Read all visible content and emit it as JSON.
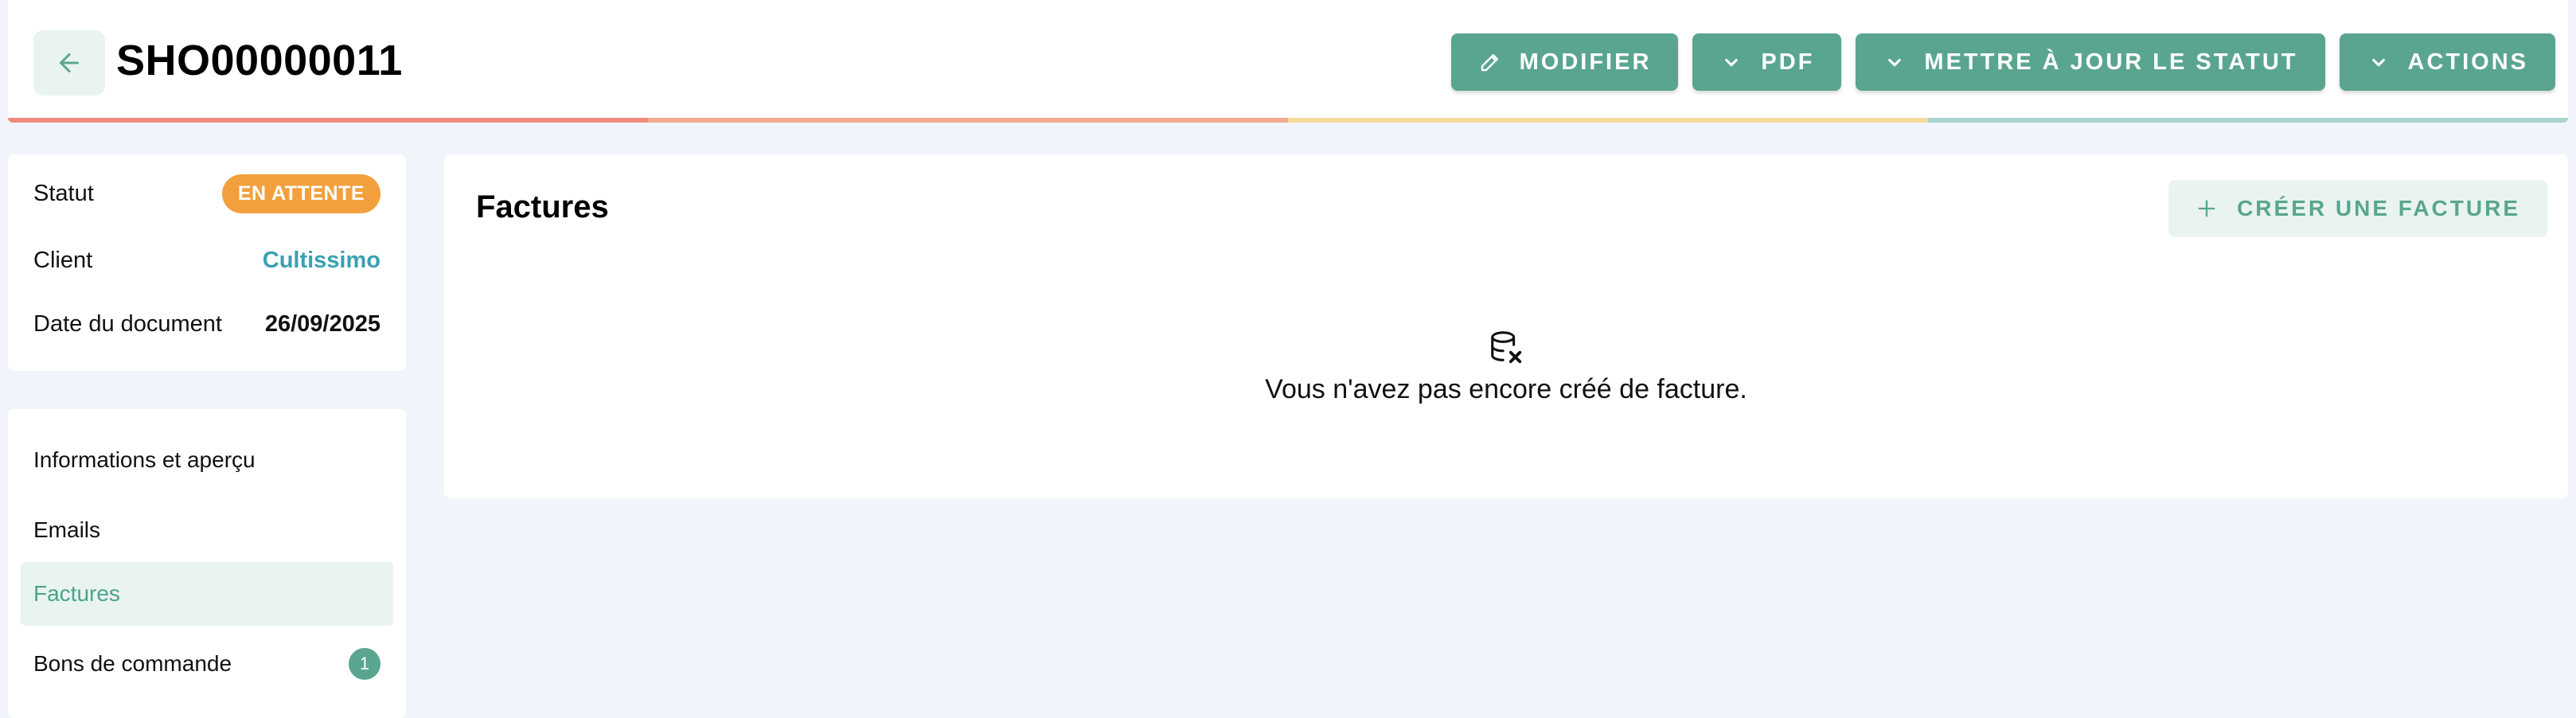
{
  "header": {
    "back_icon": "arrow-left-icon",
    "title": "SHO00000011",
    "buttons": {
      "edit": "MODIFIER",
      "pdf": "PDF",
      "update_status": "METTRE À JOUR LE STATUT",
      "actions": "ACTIONS"
    },
    "progress_colors": [
      "#ef8c81",
      "#f3a991",
      "#f7db9c",
      "#a9d4cf"
    ]
  },
  "info": {
    "status_label": "Statut",
    "status_value": "EN ATTENTE",
    "client_label": "Client",
    "client_value": "Cultissimo",
    "date_label": "Date du document",
    "date_value": "26/09/2025"
  },
  "nav": {
    "items": [
      {
        "label": "Informations et aperçu"
      },
      {
        "label": "Emails"
      },
      {
        "label": "Factures",
        "active": true
      },
      {
        "label": "Bons de commande",
        "count": "1"
      }
    ]
  },
  "main": {
    "title": "Factures",
    "create_label": "CRÉER UNE FACTURE",
    "empty_icon": "database-x-icon",
    "empty_text": "Vous n'avez pas encore créé de facture."
  },
  "colors": {
    "accent": "#5aa58f",
    "accent_light": "#e9f4f1",
    "status_pending": "#f2a03d",
    "link": "#3aa0b3",
    "background": "#f1f5fb"
  }
}
